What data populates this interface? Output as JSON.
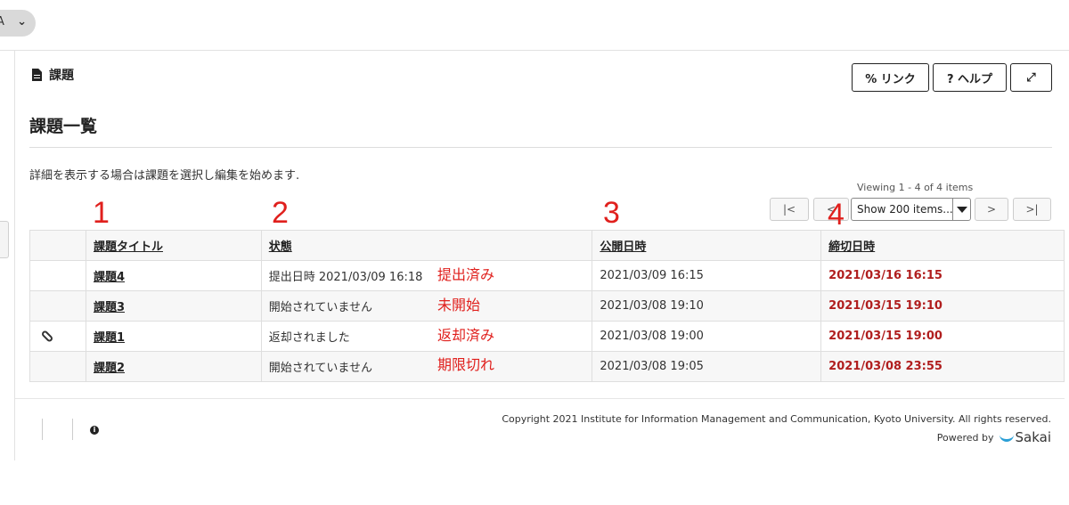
{
  "topbar": {
    "pill_letter": "A",
    "pill_chevron": "⌄"
  },
  "tool": {
    "name": "課題",
    "icon": "document-icon"
  },
  "buttons": {
    "link": "% リンク",
    "help": "? ヘルプ",
    "expand_icon": "⤢"
  },
  "page_title": "課題一覧",
  "instructions": "詳細を表示する場合は課題を選択し編集を始めます.",
  "pager": {
    "viewing": "Viewing 1 - 4 of 4 items",
    "first": "|<",
    "prev": "<",
    "next": ">",
    "last": ">|",
    "page_size": "Show 200 items..."
  },
  "annotations": {
    "col_numbers": [
      "1",
      "2",
      "3",
      "4"
    ],
    "status_notes": [
      "提出済み",
      "未開始",
      "返却済み",
      "期限切れ"
    ]
  },
  "table": {
    "headers": {
      "title": "課題タイトル",
      "status": "状態",
      "open": "公開日時",
      "due": "締切日時"
    },
    "rows": [
      {
        "attachment": false,
        "title": "課題4",
        "status": "提出日時 2021/03/09 16:18",
        "open": "2021/03/09 16:15",
        "due": "2021/03/16 16:15"
      },
      {
        "attachment": false,
        "title": "課題3",
        "status": "開始されていません",
        "open": "2021/03/08 19:10",
        "due": "2021/03/15 19:10"
      },
      {
        "attachment": true,
        "title": "課題1",
        "status": "返却されました",
        "open": "2021/03/08 19:00",
        "due": "2021/03/15 19:00"
      },
      {
        "attachment": false,
        "title": "課題2",
        "status": "開始されていません",
        "open": "2021/03/08 19:05",
        "due": "2021/03/08 23:55"
      }
    ]
  },
  "footer": {
    "copyright": "Copyright 2021 Institute for Information Management and Communication, Kyoto University. All rights reserved.",
    "powered_by": "Powered by",
    "brand": "Sakai"
  },
  "colors": {
    "due_red": "#b01e1e",
    "annotation_red": "#e0201d",
    "sakai_blue": "#2a9fd6"
  }
}
